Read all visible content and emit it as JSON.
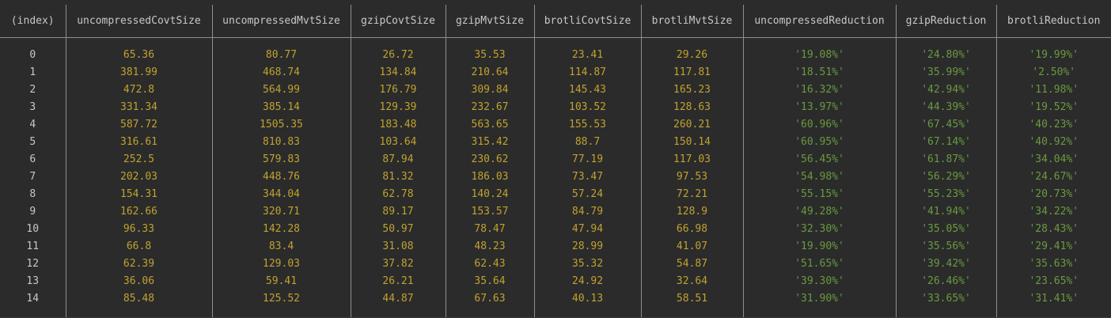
{
  "columns": [
    "(index)",
    "uncompressedCovtSize",
    "uncompressedMvtSize",
    "gzipCovtSize",
    "gzipMvtSize",
    "brotliCovtSize",
    "brotliMvtSize",
    "uncompressedReduction",
    "gzipReduction",
    "brotliReduction"
  ],
  "rows": [
    [
      "0",
      "65.36",
      "80.77",
      "26.72",
      "35.53",
      "23.41",
      "29.26",
      "'19.08%'",
      "'24.80%'",
      "'19.99%'"
    ],
    [
      "1",
      "381.99",
      "468.74",
      "134.84",
      "210.64",
      "114.87",
      "117.81",
      "'18.51%'",
      "'35.99%'",
      "'2.50%'"
    ],
    [
      "2",
      "472.8",
      "564.99",
      "176.79",
      "309.84",
      "145.43",
      "165.23",
      "'16.32%'",
      "'42.94%'",
      "'11.98%'"
    ],
    [
      "3",
      "331.34",
      "385.14",
      "129.39",
      "232.67",
      "103.52",
      "128.63",
      "'13.97%'",
      "'44.39%'",
      "'19.52%'"
    ],
    [
      "4",
      "587.72",
      "1505.35",
      "183.48",
      "563.65",
      "155.53",
      "260.21",
      "'60.96%'",
      "'67.45%'",
      "'40.23%'"
    ],
    [
      "5",
      "316.61",
      "810.83",
      "103.64",
      "315.42",
      "88.7",
      "150.14",
      "'60.95%'",
      "'67.14%'",
      "'40.92%'"
    ],
    [
      "6",
      "252.5",
      "579.83",
      "87.94",
      "230.62",
      "77.19",
      "117.03",
      "'56.45%'",
      "'61.87%'",
      "'34.04%'"
    ],
    [
      "7",
      "202.03",
      "448.76",
      "81.32",
      "186.03",
      "73.47",
      "97.53",
      "'54.98%'",
      "'56.29%'",
      "'24.67%'"
    ],
    [
      "8",
      "154.31",
      "344.04",
      "62.78",
      "140.24",
      "57.24",
      "72.21",
      "'55.15%'",
      "'55.23%'",
      "'20.73%'"
    ],
    [
      "9",
      "162.66",
      "320.71",
      "89.17",
      "153.57",
      "84.79",
      "128.9",
      "'49.28%'",
      "'41.94%'",
      "'34.22%'"
    ],
    [
      "10",
      "96.33",
      "142.28",
      "50.97",
      "78.47",
      "47.94",
      "66.98",
      "'32.30%'",
      "'35.05%'",
      "'28.43%'"
    ],
    [
      "11",
      "66.8",
      "83.4",
      "31.08",
      "48.23",
      "28.99",
      "41.07",
      "'19.90%'",
      "'35.56%'",
      "'29.41%'"
    ],
    [
      "12",
      "62.39",
      "129.03",
      "37.82",
      "62.43",
      "35.32",
      "54.87",
      "'51.65%'",
      "'39.42%'",
      "'35.63%'"
    ],
    [
      "13",
      "36.06",
      "59.41",
      "26.21",
      "35.64",
      "24.92",
      "32.64",
      "'39.30%'",
      "'26.46%'",
      "'23.65%'"
    ],
    [
      "14",
      "85.48",
      "125.52",
      "44.87",
      "67.63",
      "40.13",
      "58.51",
      "'31.90%'",
      "'33.65%'",
      "'31.41%'"
    ]
  ],
  "colors": {
    "background": "#2b2b2b",
    "number": "#c0a22f",
    "string": "#6a9a3f",
    "header": "#c8c8c8",
    "border": "#8e8e8e"
  }
}
